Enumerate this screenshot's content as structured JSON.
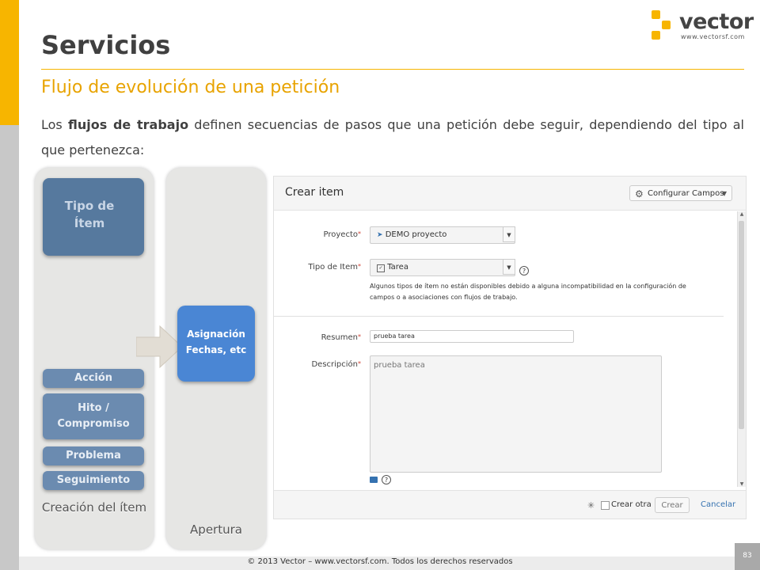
{
  "title": "Servicios",
  "subtitle": "Flujo de evolución de una petición",
  "intro": {
    "before": "Los ",
    "bold": "flujos de trabajo",
    "after": " definen secuencias de pasos que una petición debe seguir, dependiendo del tipo al que pertenezca:"
  },
  "logo": {
    "word": "vector",
    "url": "www.vectorsf.com",
    "color": "#f7b500"
  },
  "diagram": {
    "lane_left_label": "Creación del ítem",
    "lane_mid_label": "Apertura",
    "tipo_box": "Tipo de Ítem",
    "accion": "Acción",
    "hito": "Hito / Compromiso",
    "problema": "Problema",
    "seguimiento": "Seguimiento",
    "asignacion": "Asignación Fechas, etc"
  },
  "form": {
    "title": "Crear item",
    "config_button": "Configurar Campos",
    "proyecto_label": "Proyecto",
    "proyecto_value": "DEMO proyecto",
    "tipo_label": "Tipo de Item",
    "tipo_value": "Tarea",
    "hint": "Algunos tipos de ítem no están disponibles debido a alguna incompatibilidad en la configuración de campos o a asociaciones con flujos de trabajo.",
    "resumen_label": "Resumen",
    "resumen_value": "prueba tarea",
    "descripcion_label": "Descripción",
    "descripcion_value": "prueba tarea",
    "crear_otra": "Crear otra",
    "crear": "Crear",
    "cancelar": "Cancelar",
    "required_mark": "*"
  },
  "footer": {
    "copyright": "© 2013 Vector – www.vectorsf.com. Todos los derechos reservados",
    "page_number": "83"
  },
  "colors": {
    "accent": "#f7b500",
    "box_blue": "#56799e",
    "link": "#3572b0"
  }
}
